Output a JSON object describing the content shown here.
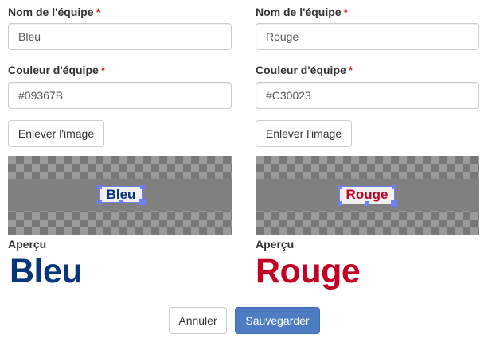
{
  "teams": [
    {
      "name_label": "Nom de l'équipe",
      "name_value": "Bleu",
      "color_label": "Couleur d'équipe",
      "color_value": "#09367B",
      "remove_image_label": "Enlever l'image",
      "editor_image_text": "Bleu",
      "preview_label": "Aperçu",
      "preview_text": "Bleu"
    },
    {
      "name_label": "Nom de l'équipe",
      "name_value": "Rouge",
      "color_label": "Couleur d'équipe",
      "color_value": "#C30023",
      "remove_image_label": "Enlever l'image",
      "editor_image_text": "Rouge",
      "preview_label": "Aperçu",
      "preview_text": "Rouge"
    }
  ],
  "required_marker": "*",
  "footer": {
    "cancel_label": "Annuler",
    "save_label": "Sauvegarder"
  },
  "colors": {
    "required": "#c9302c",
    "primary_button": "#4e7cc2",
    "team_blue": "#09367B",
    "team_red": "#C30023",
    "crop_selection": "#6f7fff"
  }
}
